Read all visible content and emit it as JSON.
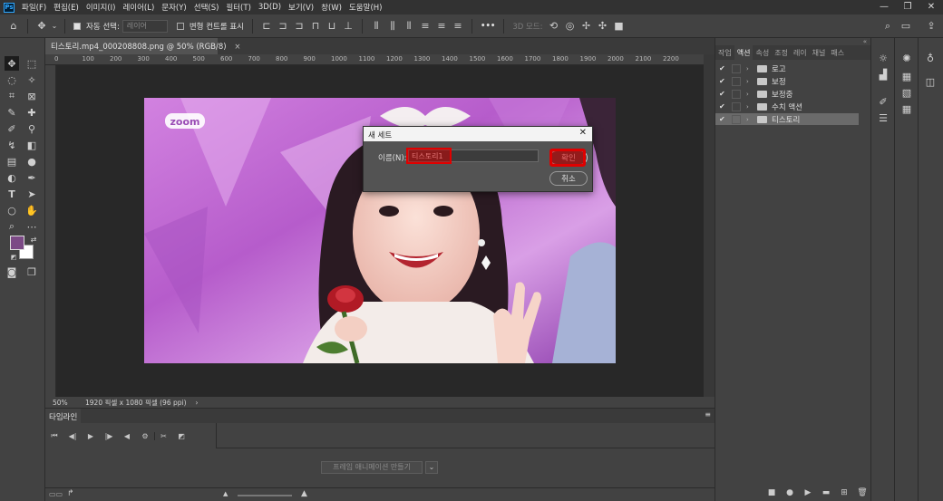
{
  "menubar": {
    "logo": "Ps",
    "items": [
      "파일(F)",
      "편집(E)",
      "이미지(I)",
      "레이어(L)",
      "문자(Y)",
      "선택(S)",
      "필터(T)",
      "3D(D)",
      "보기(V)",
      "창(W)",
      "도움말(H)"
    ],
    "window_controls": [
      "—",
      "❐",
      "✕"
    ]
  },
  "options": {
    "auto_select_label": "자동 선택:",
    "auto_select_value": "레이어",
    "transform_label": "변형 컨트롤 표시",
    "mode3d_label": "3D 모드:",
    "more": "•••"
  },
  "document": {
    "tab_title": "티스토리.mp4_000208808.png @ 50% (RGB/8)",
    "tab_close": "×",
    "ruler_ticks": [
      "0",
      "100",
      "200",
      "300",
      "400",
      "500",
      "600",
      "700",
      "800",
      "900",
      "1000",
      "1100",
      "1200",
      "1300",
      "1400",
      "1500",
      "1600",
      "1700",
      "1800",
      "1900",
      "2000",
      "2100",
      "2200"
    ],
    "photo_logo": "zoom"
  },
  "status": {
    "zoom": "50%",
    "doc_info": "1920 픽셀 x 1080 픽셀 (96 ppi)",
    "arrow": "›"
  },
  "timeline": {
    "tab": "타임라인",
    "create_button": "프레임 애니메이션 만들기",
    "dropdown": "⌄"
  },
  "panel": {
    "tabs": [
      "작업",
      "액션",
      "속성",
      "조정",
      "레이",
      "채널",
      "패스"
    ],
    "active_tab": "액션",
    "actions": [
      {
        "name": "로고",
        "checked": true
      },
      {
        "name": "보정",
        "checked": true
      },
      {
        "name": "보정중",
        "checked": true
      },
      {
        "name": "수치 액션",
        "checked": true
      },
      {
        "name": "티스토리",
        "checked": true,
        "selected": true
      }
    ]
  },
  "dialog": {
    "title": "새 세트",
    "close": "✕",
    "name_label": "이름(N):",
    "name_value": "티스토리1",
    "ok": "확인",
    "cancel": "취소"
  }
}
